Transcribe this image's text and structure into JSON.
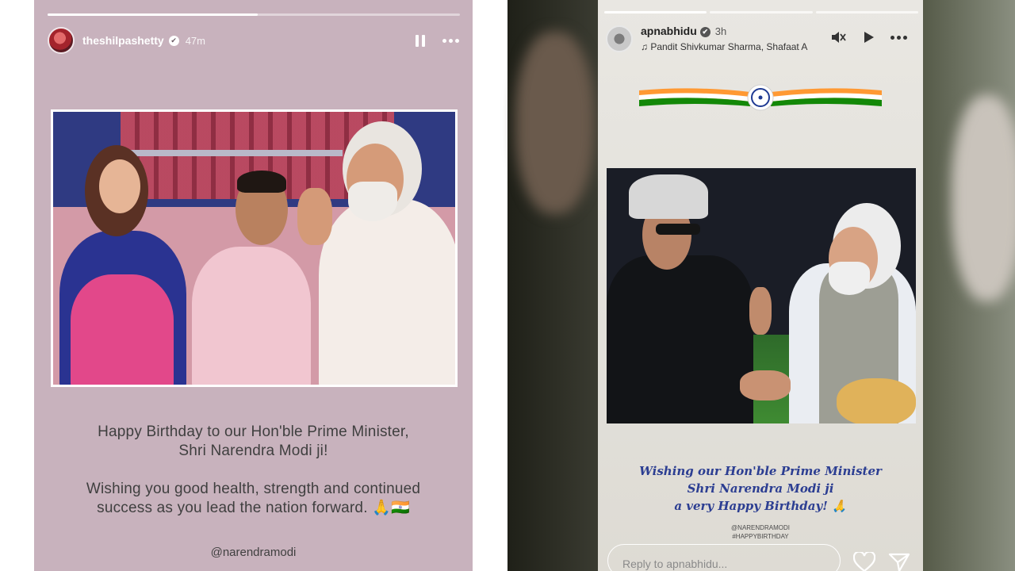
{
  "left_story": {
    "progress_fraction": 0.51,
    "username": "theshilpashetty",
    "verified_mark": "✔",
    "time": "47m",
    "pause_icon": "pause-icon",
    "more_icon": "more-options-icon",
    "caption_line1": "Happy Birthday to our Hon'ble Prime Minister,",
    "caption_line2": "Shri Narendra Modi ji!",
    "caption_line3": "Wishing you good health, strength and continued",
    "caption_line4": "success as you lead the nation forward. 🙏🇮🇳",
    "mention": "@narendramodi"
  },
  "right_story": {
    "progress_segments": 3,
    "active_segment": 0,
    "username": "apnabhidu",
    "verified_mark": "✔",
    "time": "3h",
    "music": "♫ Pandit Shivkumar Sharma, Shafaat A",
    "icons": [
      "mute-icon",
      "play-icon",
      "more-options-icon"
    ],
    "wish_line1": "Wishing our Hon'ble Prime Minister",
    "wish_line2": "Shri Narendra Modi ji",
    "wish_line3": "a very Happy Birthday! 🙏",
    "tag1": "@NARENDRAMODI",
    "tag2": "#HAPPYBIRTHDAY",
    "reply_placeholder": "Reply to apnabhidu...",
    "colors": {
      "wish_text": "#2c3e92",
      "saffron": "#ff9933",
      "green": "#138808",
      "chakra": "#1f3a93"
    }
  }
}
